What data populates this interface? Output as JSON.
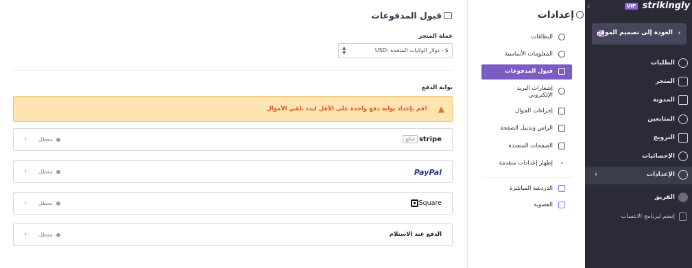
{
  "nav": {
    "collapse_glyph": "‹",
    "vip_badge": "VIP",
    "logo": "strikingly",
    "back_label": "العودة إلى تصميم الموقع",
    "items": [
      {
        "label": "الطلبات",
        "icon": "dollar-icon"
      },
      {
        "label": "المتجر",
        "icon": "store-icon"
      },
      {
        "label": "المدونة",
        "icon": "pen-icon"
      },
      {
        "label": "المتابعين",
        "icon": "users-icon"
      },
      {
        "label": "الترويج",
        "icon": "megaphone-icon"
      },
      {
        "label": "الإحصائيات",
        "icon": "chart-icon"
      },
      {
        "label": "الإعدادات",
        "icon": "gear-icon",
        "active": true
      },
      {
        "label": "الفريق",
        "icon": "team-icon"
      },
      {
        "label": "إنضم لبرنامج الانتساب",
        "icon": "trophy-icon"
      }
    ]
  },
  "settings_menu": {
    "title": "إعدادات",
    "items": [
      {
        "label": "النطاقات",
        "icon": "globe-icon"
      },
      {
        "label": "المعلومات الأساسية",
        "icon": "info-icon"
      },
      {
        "label": "قبول المدفوعات",
        "icon": "card-icon",
        "active": true
      },
      {
        "label": "إشعارات البريد الإلكتروني",
        "icon": "bell-icon"
      },
      {
        "label": "إجراءات الجوال",
        "icon": "mobile-icon"
      },
      {
        "label": "الراس وتذييل الصفحة",
        "icon": "header-icon"
      },
      {
        "label": "الصفحات المتعددة",
        "icon": "pages-icon"
      },
      {
        "label": "إظهار إعدادات متقدمة",
        "icon": "chevron-down-icon"
      },
      {
        "label": "الدردشة المباشرة",
        "icon": "chat-icon"
      },
      {
        "label": "العضوية",
        "icon": "member-icon"
      }
    ]
  },
  "main": {
    "title": "قبول المدفوعات",
    "currency_label": "عملة المتجر",
    "currency_value": "USD: دولار الولايات المتحدة - $",
    "gateway_label": "بوابة الدفع",
    "alert": "قم بإعداد بوابة دفع واحدة على الأقل لبدء تلقي الأموال!",
    "gateways": [
      {
        "name": "stripe",
        "badge": "شائع",
        "status": "معطل"
      },
      {
        "name": "PayPal",
        "status": "معطل"
      },
      {
        "name": "Square",
        "status": "معطل"
      },
      {
        "name": "الدفع عند الاستلام",
        "status": "معطل"
      }
    ]
  }
}
